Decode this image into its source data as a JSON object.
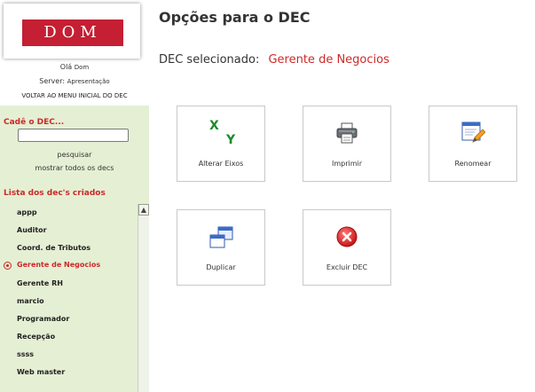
{
  "sidebar": {
    "logo_text": "DOM",
    "greeting_label": "Olá",
    "user": "Dom",
    "server_label": "Server:",
    "server": "Apresentação",
    "back_link": "VOLTAR AO MENU INICIAL DO DEC",
    "search_title": "Cadê o DEC...",
    "search_value": "",
    "search_link": "pesquisar",
    "show_all_link": "mostrar todos os decs",
    "list_title": "Lista dos dec's criados",
    "items": [
      {
        "label": "appp"
      },
      {
        "label": "Auditor"
      },
      {
        "label": "Coord. de Tributos"
      },
      {
        "label": "Gerente de Negocios",
        "selected": true
      },
      {
        "label": "Gerente RH"
      },
      {
        "label": "marcio"
      },
      {
        "label": "Programador"
      },
      {
        "label": "Recepção"
      },
      {
        "label": "ssss"
      },
      {
        "label": "Web master"
      }
    ]
  },
  "main": {
    "title": "Opções para o DEC",
    "selected_label": "DEC selecionado:",
    "selected_name": "Gerente de Negocios",
    "actions": [
      {
        "label": "Alterar Eixos",
        "icon": "xy-axes-icon"
      },
      {
        "label": "Imprimir",
        "icon": "printer-icon"
      },
      {
        "label": "Renomear",
        "icon": "rename-icon"
      },
      {
        "label": "Duplicar",
        "icon": "duplicate-icon"
      },
      {
        "label": "Excluir DEC",
        "icon": "delete-icon"
      }
    ]
  },
  "colors": {
    "accent": "#cc2a2a",
    "logo_red": "#c41f33",
    "sidebar_green": "#e5efd4",
    "axis_green": "#1c8a2a"
  }
}
